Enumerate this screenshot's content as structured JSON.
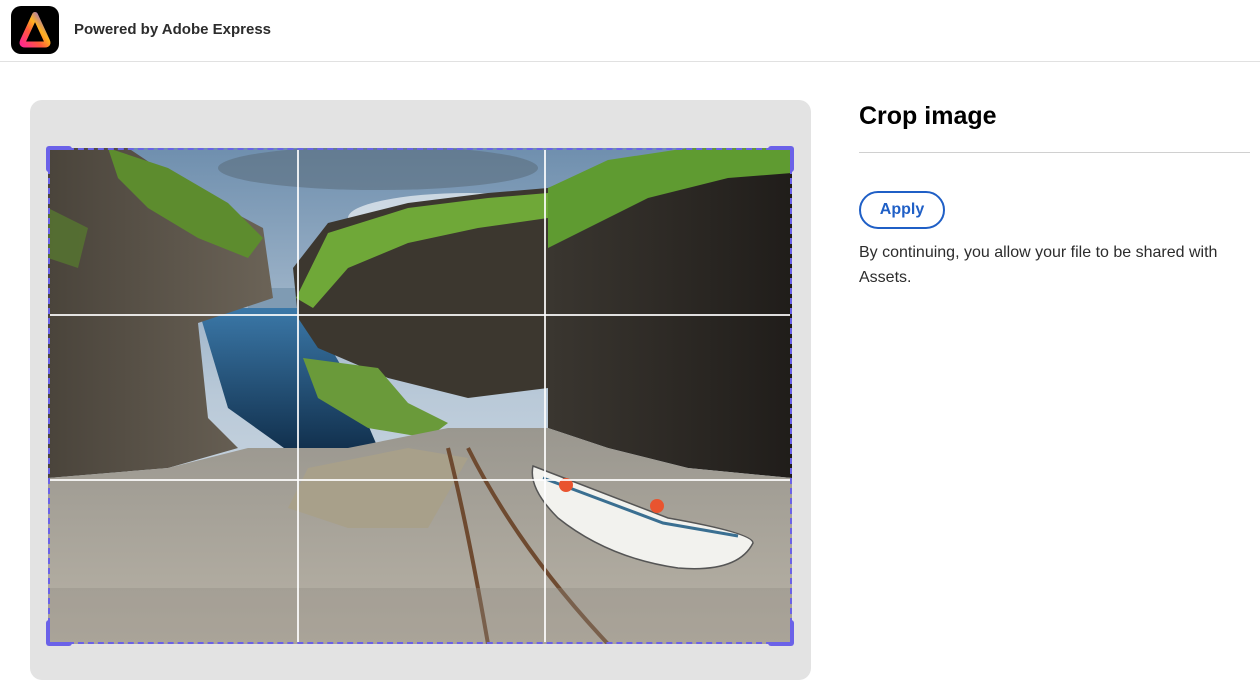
{
  "header": {
    "logo_icon": "adobe-express-logo",
    "powered_by": "Powered by Adobe Express"
  },
  "editor": {
    "image_description_icon": "landscape-photo",
    "crop_frame_color": "#6b62e8",
    "panel_background": "#e3e3e3"
  },
  "side_panel": {
    "title": "Crop image",
    "apply_label": "Apply",
    "notice": "By continuing, you allow your file to be shared with Assets."
  },
  "colors": {
    "accent_blue": "#1f5fc6",
    "crop_purple": "#6b62e8"
  }
}
